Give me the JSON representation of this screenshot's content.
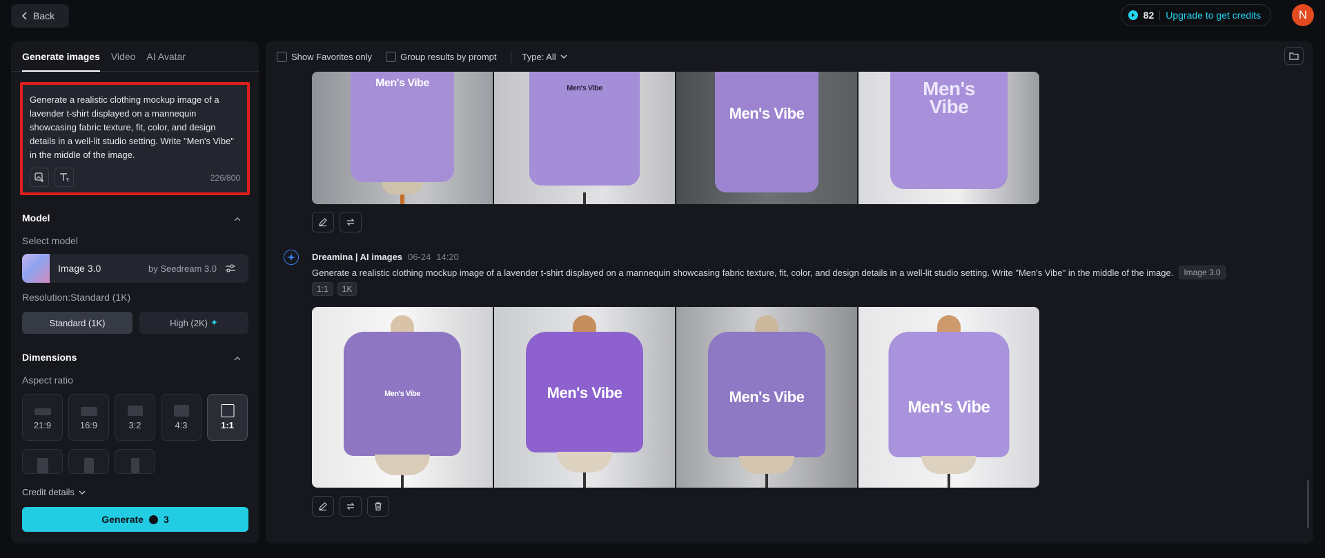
{
  "topbar": {
    "back_label": "Back",
    "credits_count": "82",
    "upgrade_label": "Upgrade to get credits",
    "avatar_initial": "N"
  },
  "left_panel": {
    "tabs": [
      {
        "label": "Generate images",
        "active": true
      },
      {
        "label": "Video",
        "active": false
      },
      {
        "label": "AI Avatar",
        "active": false
      }
    ],
    "prompt": {
      "text": "Generate a realistic clothing mockup image of a lavender t-shirt displayed on a mannequin showcasing fabric texture, fit, color, and design details in a well-lit studio setting.  Write \"Men's Vibe\" in the middle of the image.",
      "counter": "226/800"
    },
    "model": {
      "section_title": "Model",
      "select_label": "Select model",
      "name": "Image 3.0",
      "by": "by Seedream 3.0",
      "resolution_label": "Resolution:Standard (1K)",
      "res_standard": "Standard (1K)",
      "res_high": "High (2K)"
    },
    "dimensions": {
      "section_title": "Dimensions",
      "aspect_label": "Aspect ratio",
      "ratios": [
        "21:9",
        "16:9",
        "3:2",
        "4:3",
        "1:1"
      ],
      "selected": "1:1"
    },
    "credit_details_label": "Credit details",
    "generate_label": "Generate",
    "generate_cost": "3"
  },
  "right_panel": {
    "filters": {
      "favorites_label": "Show Favorites only",
      "group_label": "Group results by prompt",
      "type_label": "Type: All"
    },
    "first_batch": {
      "texts": [
        "Men's Vibe",
        "Men's Vibe",
        "Men's Vibe",
        "Men's\nVibe"
      ]
    },
    "second_batch": {
      "source": "Dreamina | AI images",
      "date": "06-24",
      "time": "14:20",
      "prompt": "Generate a realistic clothing mockup image of a lavender t-shirt displayed on a mannequin showcasing fabric texture, fit, color, and design details in a well-lit studio setting. Write \"Men's Vibe\" in the middle of the image.",
      "model_tag": "Image 3.0",
      "ratio_tag": "1:1",
      "res_tag": "1K",
      "texts": [
        "Men's Vibe",
        "Men's Vibe",
        "Men's Vibe",
        "Men's Vibe"
      ]
    }
  },
  "colors": {
    "accent": "#22cde4",
    "highlight_border": "#e11d1d",
    "shirt_lavender": "#a38ad6"
  }
}
